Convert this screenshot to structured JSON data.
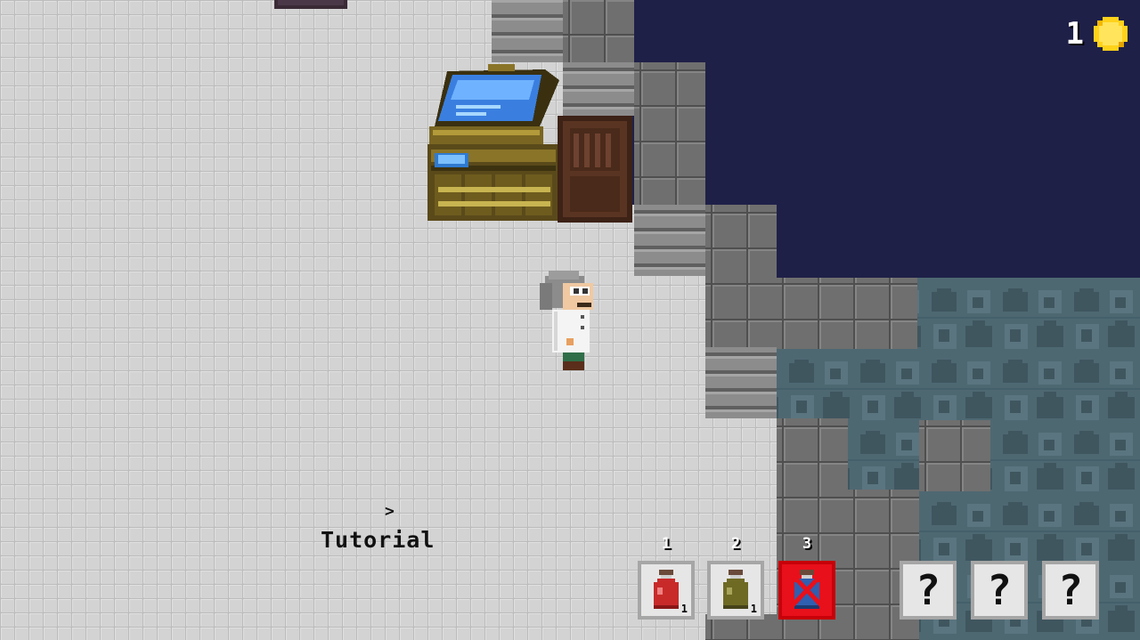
{
  "hud": {
    "coins": "1",
    "coin_icon": "gold-coin-icon"
  },
  "tutorial": {
    "arrow": ">",
    "label": "Tutorial"
  },
  "hotbar": {
    "slots": [
      {
        "number": "1",
        "item": "red-potion-icon",
        "count": "1",
        "state": "available"
      },
      {
        "number": "2",
        "item": "olive-potion-icon",
        "count": "1",
        "state": "available"
      },
      {
        "number": "3",
        "item": "blue-potion-icon",
        "count": "",
        "state": "selected-unavailable"
      }
    ],
    "locked_slots": [
      {
        "label": "?"
      },
      {
        "label": "?"
      },
      {
        "label": "?"
      }
    ]
  },
  "colors": {
    "void": "#1f2048",
    "lab_floor": "#cfcfcf",
    "stone_wall": "#6f6f6f",
    "cave_floor": "#4c6670",
    "selected_slot": "#e8101a",
    "coin": "#ffd21a"
  }
}
